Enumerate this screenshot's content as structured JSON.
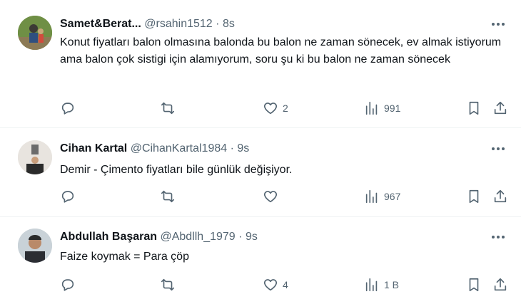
{
  "tweets": [
    {
      "name": "Samet&Berat...",
      "handle": "@rsahin1512",
      "separator": "·",
      "time": "8s",
      "text": "Konut fiyatları balon olmasına balonda bu balon ne zaman sönecek, ev almak istiyorum ama balon çok sistigi için alamıyorum, soru şu ki bu balon ne zaman sönecek",
      "reply_count": "",
      "retweet_count": "",
      "like_count": "2",
      "view_count": "991"
    },
    {
      "name": "Cihan Kartal",
      "handle": "@CihanKartal1984",
      "separator": "·",
      "time": "9s",
      "text": "Demir - Çimento fiyatları bile günlük değişiyor.",
      "reply_count": "",
      "retweet_count": "",
      "like_count": "",
      "view_count": "967"
    },
    {
      "name": "Abdullah Başaran",
      "handle": "@Abdllh_1979",
      "separator": "·",
      "time": "9s",
      "text": "Faize koymak = Para çöp",
      "reply_count": "",
      "retweet_count": "",
      "like_count": "4",
      "view_count": "1 B"
    }
  ],
  "icons": {
    "more": "more-icon",
    "reply": "reply-icon",
    "retweet": "retweet-icon",
    "like": "heart-icon",
    "views": "views-icon",
    "bookmark": "bookmark-icon",
    "share": "share-icon"
  },
  "colors": {
    "text": "#0f1419",
    "secondary": "#536471",
    "divider": "#eff3f4"
  }
}
